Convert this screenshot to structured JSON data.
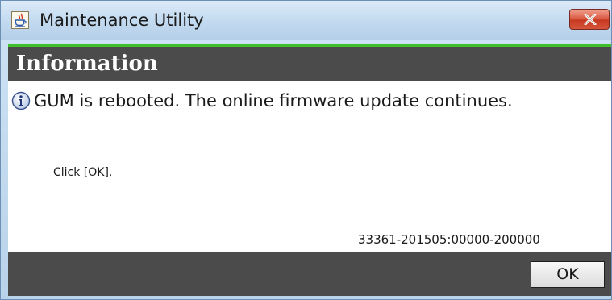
{
  "window": {
    "title": "Maintenance Utility",
    "app_icon": "java-cup-icon",
    "close_icon": "close-icon",
    "colors": {
      "close_button": "#d4553a",
      "accent_line": "#3fbf2a",
      "bars": "#4b4b4b"
    }
  },
  "dialog": {
    "header_title": "Information",
    "icon": "info-icon",
    "message": "GUM is rebooted. The online firmware update continues.",
    "instruction": "Click [OK].",
    "code": "33361-201505:00000-200000",
    "ok_label": "OK"
  }
}
